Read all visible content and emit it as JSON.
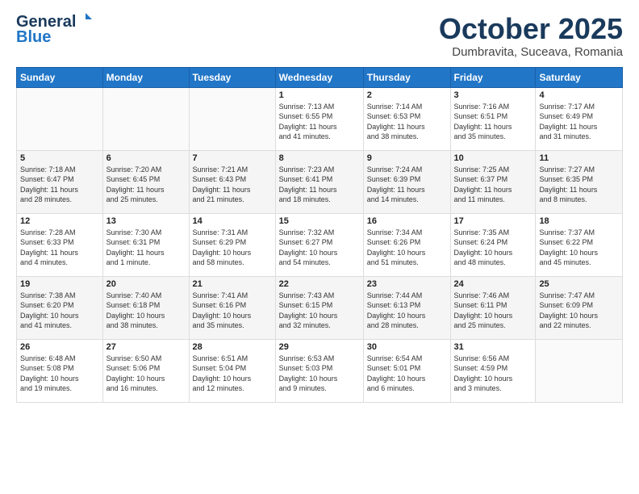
{
  "header": {
    "logo_line1": "General",
    "logo_line2": "Blue",
    "month": "October 2025",
    "location": "Dumbravita, Suceava, Romania"
  },
  "weekdays": [
    "Sunday",
    "Monday",
    "Tuesday",
    "Wednesday",
    "Thursday",
    "Friday",
    "Saturday"
  ],
  "weeks": [
    [
      {
        "day": "",
        "info": ""
      },
      {
        "day": "",
        "info": ""
      },
      {
        "day": "",
        "info": ""
      },
      {
        "day": "1",
        "info": "Sunrise: 7:13 AM\nSunset: 6:55 PM\nDaylight: 11 hours\nand 41 minutes."
      },
      {
        "day": "2",
        "info": "Sunrise: 7:14 AM\nSunset: 6:53 PM\nDaylight: 11 hours\nand 38 minutes."
      },
      {
        "day": "3",
        "info": "Sunrise: 7:16 AM\nSunset: 6:51 PM\nDaylight: 11 hours\nand 35 minutes."
      },
      {
        "day": "4",
        "info": "Sunrise: 7:17 AM\nSunset: 6:49 PM\nDaylight: 11 hours\nand 31 minutes."
      }
    ],
    [
      {
        "day": "5",
        "info": "Sunrise: 7:18 AM\nSunset: 6:47 PM\nDaylight: 11 hours\nand 28 minutes."
      },
      {
        "day": "6",
        "info": "Sunrise: 7:20 AM\nSunset: 6:45 PM\nDaylight: 11 hours\nand 25 minutes."
      },
      {
        "day": "7",
        "info": "Sunrise: 7:21 AM\nSunset: 6:43 PM\nDaylight: 11 hours\nand 21 minutes."
      },
      {
        "day": "8",
        "info": "Sunrise: 7:23 AM\nSunset: 6:41 PM\nDaylight: 11 hours\nand 18 minutes."
      },
      {
        "day": "9",
        "info": "Sunrise: 7:24 AM\nSunset: 6:39 PM\nDaylight: 11 hours\nand 14 minutes."
      },
      {
        "day": "10",
        "info": "Sunrise: 7:25 AM\nSunset: 6:37 PM\nDaylight: 11 hours\nand 11 minutes."
      },
      {
        "day": "11",
        "info": "Sunrise: 7:27 AM\nSunset: 6:35 PM\nDaylight: 11 hours\nand 8 minutes."
      }
    ],
    [
      {
        "day": "12",
        "info": "Sunrise: 7:28 AM\nSunset: 6:33 PM\nDaylight: 11 hours\nand 4 minutes."
      },
      {
        "day": "13",
        "info": "Sunrise: 7:30 AM\nSunset: 6:31 PM\nDaylight: 11 hours\nand 1 minute."
      },
      {
        "day": "14",
        "info": "Sunrise: 7:31 AM\nSunset: 6:29 PM\nDaylight: 10 hours\nand 58 minutes."
      },
      {
        "day": "15",
        "info": "Sunrise: 7:32 AM\nSunset: 6:27 PM\nDaylight: 10 hours\nand 54 minutes."
      },
      {
        "day": "16",
        "info": "Sunrise: 7:34 AM\nSunset: 6:26 PM\nDaylight: 10 hours\nand 51 minutes."
      },
      {
        "day": "17",
        "info": "Sunrise: 7:35 AM\nSunset: 6:24 PM\nDaylight: 10 hours\nand 48 minutes."
      },
      {
        "day": "18",
        "info": "Sunrise: 7:37 AM\nSunset: 6:22 PM\nDaylight: 10 hours\nand 45 minutes."
      }
    ],
    [
      {
        "day": "19",
        "info": "Sunrise: 7:38 AM\nSunset: 6:20 PM\nDaylight: 10 hours\nand 41 minutes."
      },
      {
        "day": "20",
        "info": "Sunrise: 7:40 AM\nSunset: 6:18 PM\nDaylight: 10 hours\nand 38 minutes."
      },
      {
        "day": "21",
        "info": "Sunrise: 7:41 AM\nSunset: 6:16 PM\nDaylight: 10 hours\nand 35 minutes."
      },
      {
        "day": "22",
        "info": "Sunrise: 7:43 AM\nSunset: 6:15 PM\nDaylight: 10 hours\nand 32 minutes."
      },
      {
        "day": "23",
        "info": "Sunrise: 7:44 AM\nSunset: 6:13 PM\nDaylight: 10 hours\nand 28 minutes."
      },
      {
        "day": "24",
        "info": "Sunrise: 7:46 AM\nSunset: 6:11 PM\nDaylight: 10 hours\nand 25 minutes."
      },
      {
        "day": "25",
        "info": "Sunrise: 7:47 AM\nSunset: 6:09 PM\nDaylight: 10 hours\nand 22 minutes."
      }
    ],
    [
      {
        "day": "26",
        "info": "Sunrise: 6:48 AM\nSunset: 5:08 PM\nDaylight: 10 hours\nand 19 minutes."
      },
      {
        "day": "27",
        "info": "Sunrise: 6:50 AM\nSunset: 5:06 PM\nDaylight: 10 hours\nand 16 minutes."
      },
      {
        "day": "28",
        "info": "Sunrise: 6:51 AM\nSunset: 5:04 PM\nDaylight: 10 hours\nand 12 minutes."
      },
      {
        "day": "29",
        "info": "Sunrise: 6:53 AM\nSunset: 5:03 PM\nDaylight: 10 hours\nand 9 minutes."
      },
      {
        "day": "30",
        "info": "Sunrise: 6:54 AM\nSunset: 5:01 PM\nDaylight: 10 hours\nand 6 minutes."
      },
      {
        "day": "31",
        "info": "Sunrise: 6:56 AM\nSunset: 4:59 PM\nDaylight: 10 hours\nand 3 minutes."
      },
      {
        "day": "",
        "info": ""
      }
    ]
  ]
}
